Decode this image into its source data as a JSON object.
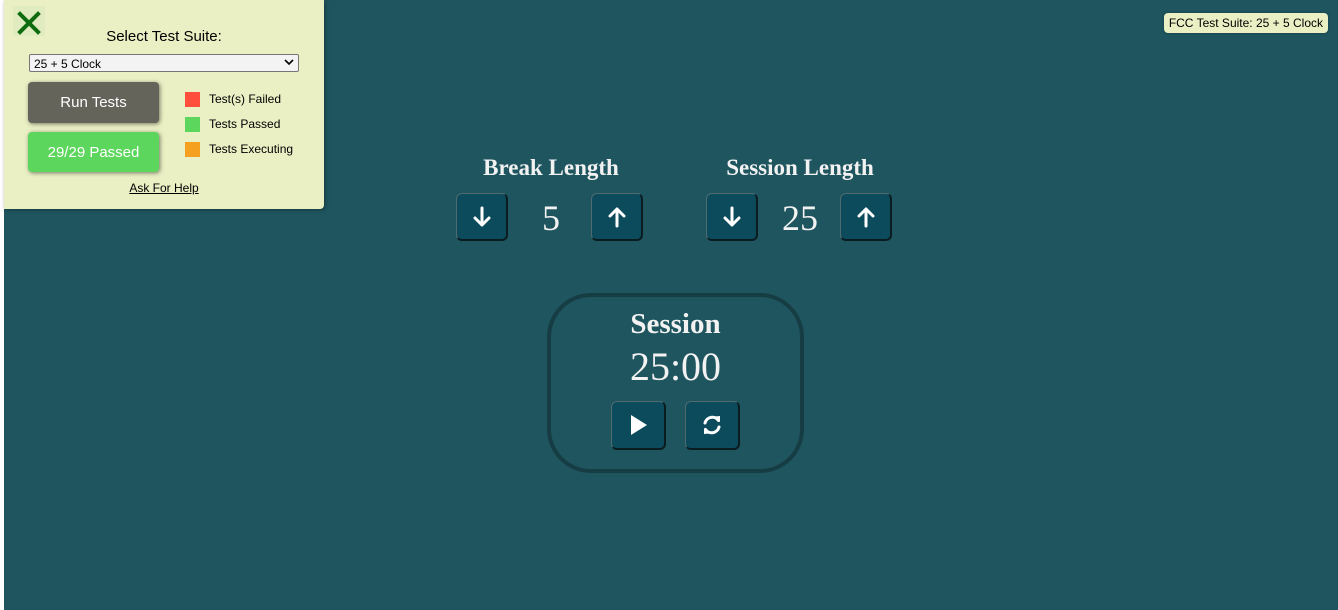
{
  "test_panel": {
    "close_icon": "close-x-icon",
    "suite_label": "Select Test Suite:",
    "suite_selected": "25 + 5 Clock",
    "run_tests_label": "Run Tests",
    "passed_label": "29/29 Passed",
    "legend": [
      {
        "label": "Test(s) Failed",
        "color": "#ff4e3c"
      },
      {
        "label": "Tests Passed",
        "color": "#5cd65c"
      },
      {
        "label": "Tests Executing",
        "color": "#f5a01e"
      }
    ],
    "help_link": "Ask For Help"
  },
  "badge": "FCC Test Suite: 25 + 5 Clock",
  "clock": {
    "break_label": "Break Length",
    "break_value": "5",
    "session_label": "Session Length",
    "session_value": "25",
    "timer_label": "Session",
    "time_left": "25:00",
    "icons": {
      "decrement": "arrow-down-icon",
      "increment": "arrow-up-icon",
      "start_stop": "play-icon",
      "reset": "refresh-icon"
    }
  },
  "colors": {
    "background": "#1f555f",
    "panel": "#eaf0c4",
    "button": "#0c4b5c",
    "run_button": "#64645a",
    "passed_button": "#5cd65c"
  }
}
